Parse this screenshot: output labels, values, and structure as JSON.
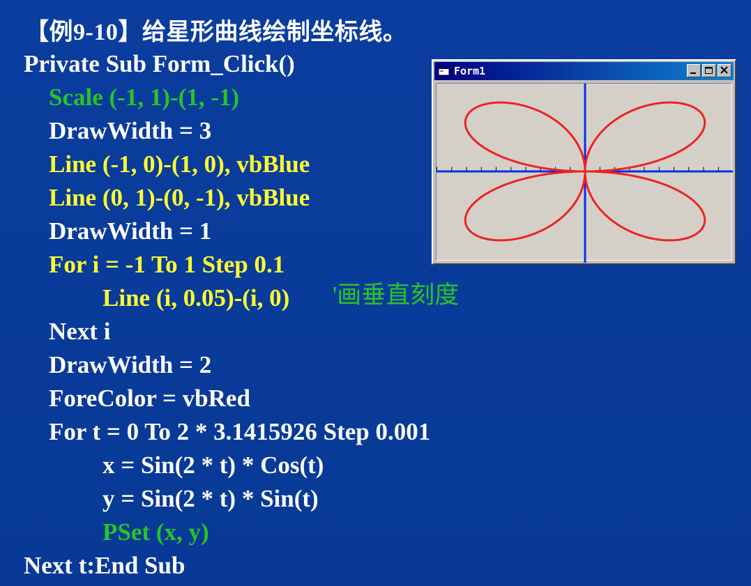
{
  "slide": {
    "title": "【例9-10】给星形曲线绘制坐标线。",
    "code_lines": [
      {
        "text": "Private Sub Form_Click()",
        "color": "white"
      },
      {
        "text": "Scale (-1, 1)-(1, -1)",
        "color": "green"
      },
      {
        "text": "DrawWidth = 3",
        "color": "white"
      },
      {
        "text": "Line (-1, 0)-(1, 0), vbBlue",
        "color": "yellow"
      },
      {
        "text": "Line (0, 1)-(0, -1), vbBlue",
        "color": "yellow"
      },
      {
        "text": "DrawWidth = 1",
        "color": "white"
      },
      {
        "text": "For i = -1 To 1 Step 0.1",
        "color": "yellow"
      },
      {
        "text": "Line (i, 0.05)-(i, 0)",
        "color": "yellow"
      },
      {
        "text": "Next i",
        "color": "white"
      },
      {
        "text": "DrawWidth = 2",
        "color": "white"
      },
      {
        "text": "ForeColor = vbRed",
        "color": "white"
      },
      {
        "text": "For t = 0 To 2 * 3.1415926 Step 0.001",
        "color": "white"
      },
      {
        "text": "x = Sin(2 * t) * Cos(t)",
        "color": "white"
      },
      {
        "text": "y = Sin(2 * t) * Sin(t)",
        "color": "white"
      },
      {
        "text": "PSet (x, y)",
        "color": "green"
      },
      {
        "text": "Next t:End Sub",
        "color": "white"
      }
    ],
    "comment": "'画垂直刻度",
    "colors": {
      "background": "#083a9a",
      "white_text": "#ffffff",
      "yellow_text": "#ffff33",
      "green_text": "#27c427",
      "axis_blue": "#0a2ee8",
      "curve_red": "#ee2222"
    }
  },
  "window": {
    "title": "Form1",
    "icons": {
      "app": "form-app-icon",
      "minimize": "minimize-icon",
      "maximize": "maximize-icon",
      "close": "close-icon"
    }
  }
}
